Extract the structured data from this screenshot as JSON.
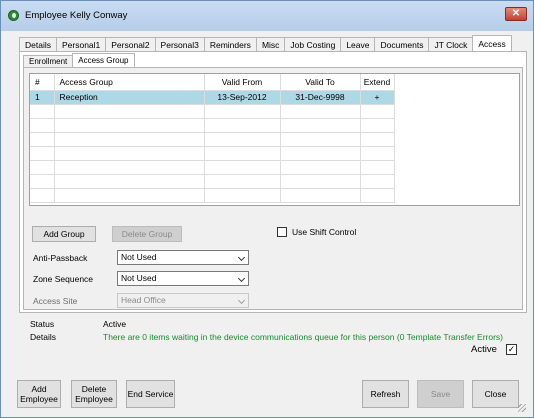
{
  "window": {
    "title": "Employee Kelly Conway",
    "close_glyph": "✕"
  },
  "tabs": [
    "Details",
    "Personal1",
    "Personal2",
    "Personal3",
    "Reminders",
    "Misc",
    "Job Costing",
    "Leave",
    "Documents",
    "JT Clock",
    "Access"
  ],
  "active_tab": "Access",
  "subtabs": [
    "Enrollment",
    "Access Group"
  ],
  "active_subtab": "Access Group",
  "grid": {
    "columns": [
      "#",
      "Access Group",
      "Valid From",
      "Valid To",
      "Extend"
    ],
    "rows": [
      {
        "num": "1",
        "group": "Reception",
        "from": "13-Sep-2012",
        "to": "31-Dec-9998",
        "extend": "+"
      }
    ]
  },
  "buttons": {
    "add_group": "Add Group",
    "delete_group": "Delete Group"
  },
  "shift_control": {
    "label": "Use Shift Control",
    "checked": false
  },
  "fields": {
    "anti_passback": {
      "label": "Anti-Passback",
      "value": "Not Used"
    },
    "zone_sequence": {
      "label": "Zone Sequence",
      "value": "Not Used"
    },
    "access_site": {
      "label": "Access Site",
      "value": "Head Office"
    }
  },
  "status": {
    "status_label": "Status",
    "status_value": "Active",
    "details_label": "Details",
    "details_value": "There are 0 items waiting in the device communications queue for this person (0 Template Transfer Errors)"
  },
  "active_checkbox": {
    "label": "Active",
    "checked": true,
    "check_glyph": "✓"
  },
  "footer": {
    "add_employee": "Add Employee",
    "delete_employee": "Delete Employee",
    "end_service": "End Service",
    "refresh": "Refresh",
    "save": "Save",
    "close": "Close"
  },
  "colors": {
    "selected_row": "#add8e6",
    "details_text": "#1b8a2e"
  }
}
